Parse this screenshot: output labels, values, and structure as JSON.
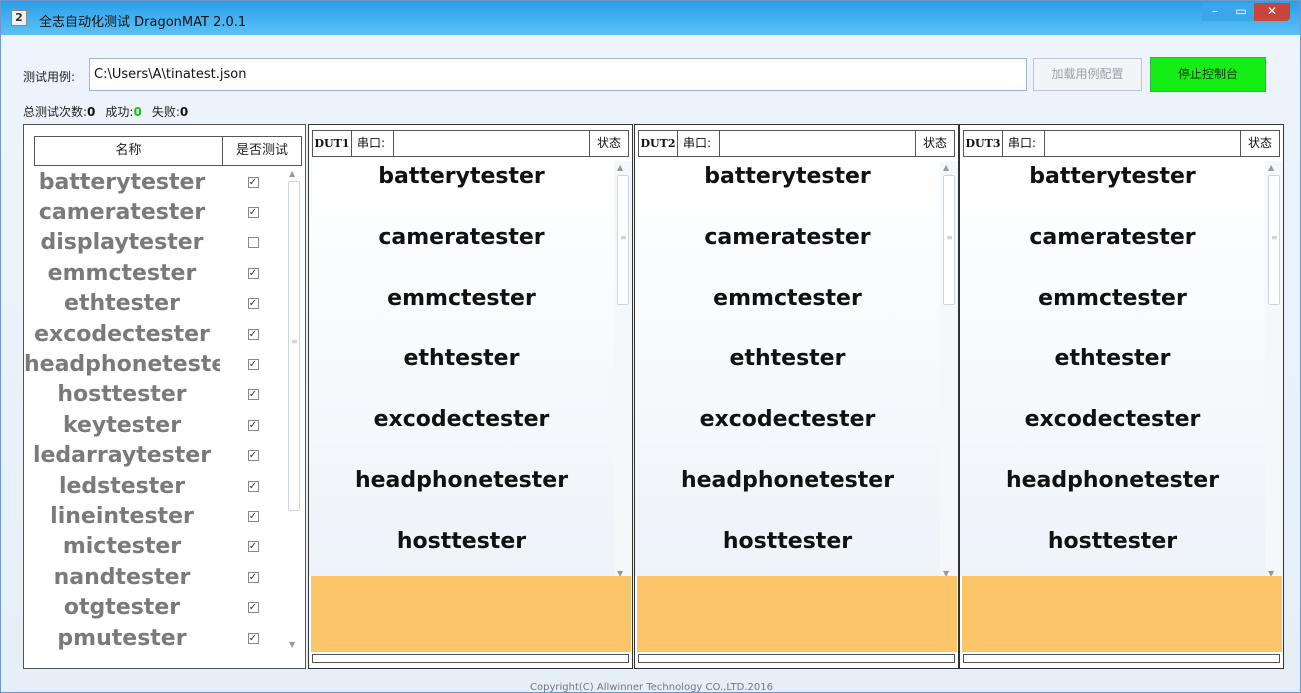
{
  "window": {
    "title": "全志自动化测试 DragonMAT 2.0.1",
    "icon_glyph": "2",
    "controls": {
      "minimize": "–",
      "maximize": "▭",
      "close": "✕"
    }
  },
  "toolbar": {
    "case_label": "测试用例:",
    "case_path": "C:\\Users\\A\\tinatest.json",
    "load_button": "加载用例配置",
    "stop_button": "停止控制台"
  },
  "stats": {
    "total_label": "总测试次数:",
    "total_value": "0",
    "success_label": "成功:",
    "success_value": "0",
    "fail_label": "失败:",
    "fail_value": "0"
  },
  "test_list": {
    "col_name": "名称",
    "col_test": "是否测试",
    "items": [
      {
        "name": "batterytester",
        "checked": true
      },
      {
        "name": "cameratester",
        "checked": true
      },
      {
        "name": "displaytester",
        "checked": false
      },
      {
        "name": "emmctester",
        "checked": true
      },
      {
        "name": "ethtester",
        "checked": true
      },
      {
        "name": "excodectester",
        "checked": true
      },
      {
        "name": "headphonetester",
        "checked": true
      },
      {
        "name": "hosttester",
        "checked": true
      },
      {
        "name": "keytester",
        "checked": true
      },
      {
        "name": "ledarraytester",
        "checked": true
      },
      {
        "name": "ledstester",
        "checked": true
      },
      {
        "name": "lineintester",
        "checked": true
      },
      {
        "name": "mictester",
        "checked": true
      },
      {
        "name": "nandtester",
        "checked": true
      },
      {
        "name": "otgtester",
        "checked": true
      },
      {
        "name": "pmutester",
        "checked": true
      }
    ]
  },
  "duts": [
    {
      "id": "DUT1",
      "port_label": "串口:",
      "port_value": "",
      "status_label": "状态",
      "items": [
        "batterytester",
        "cameratester",
        "emmctester",
        "ethtester",
        "excodectester",
        "headphonetester",
        "hosttester"
      ]
    },
    {
      "id": "DUT2",
      "port_label": "串口:",
      "port_value": "",
      "status_label": "状态",
      "items": [
        "batterytester",
        "cameratester",
        "emmctester",
        "ethtester",
        "excodectester",
        "headphonetester",
        "hosttester"
      ]
    },
    {
      "id": "DUT3",
      "port_label": "串口:",
      "port_value": "",
      "status_label": "状态",
      "items": [
        "batterytester",
        "cameratester",
        "emmctester",
        "ethtester",
        "excodectester",
        "headphonetester",
        "hosttester"
      ]
    }
  ],
  "colors": {
    "titlebar": "#3aa9ee",
    "stop_button": "#14ee14",
    "dut_status_area": "#fdc56a",
    "success_count": "#17c317"
  },
  "footer": "Copyright(C) Allwinner Technology CO.,LTD.2016"
}
